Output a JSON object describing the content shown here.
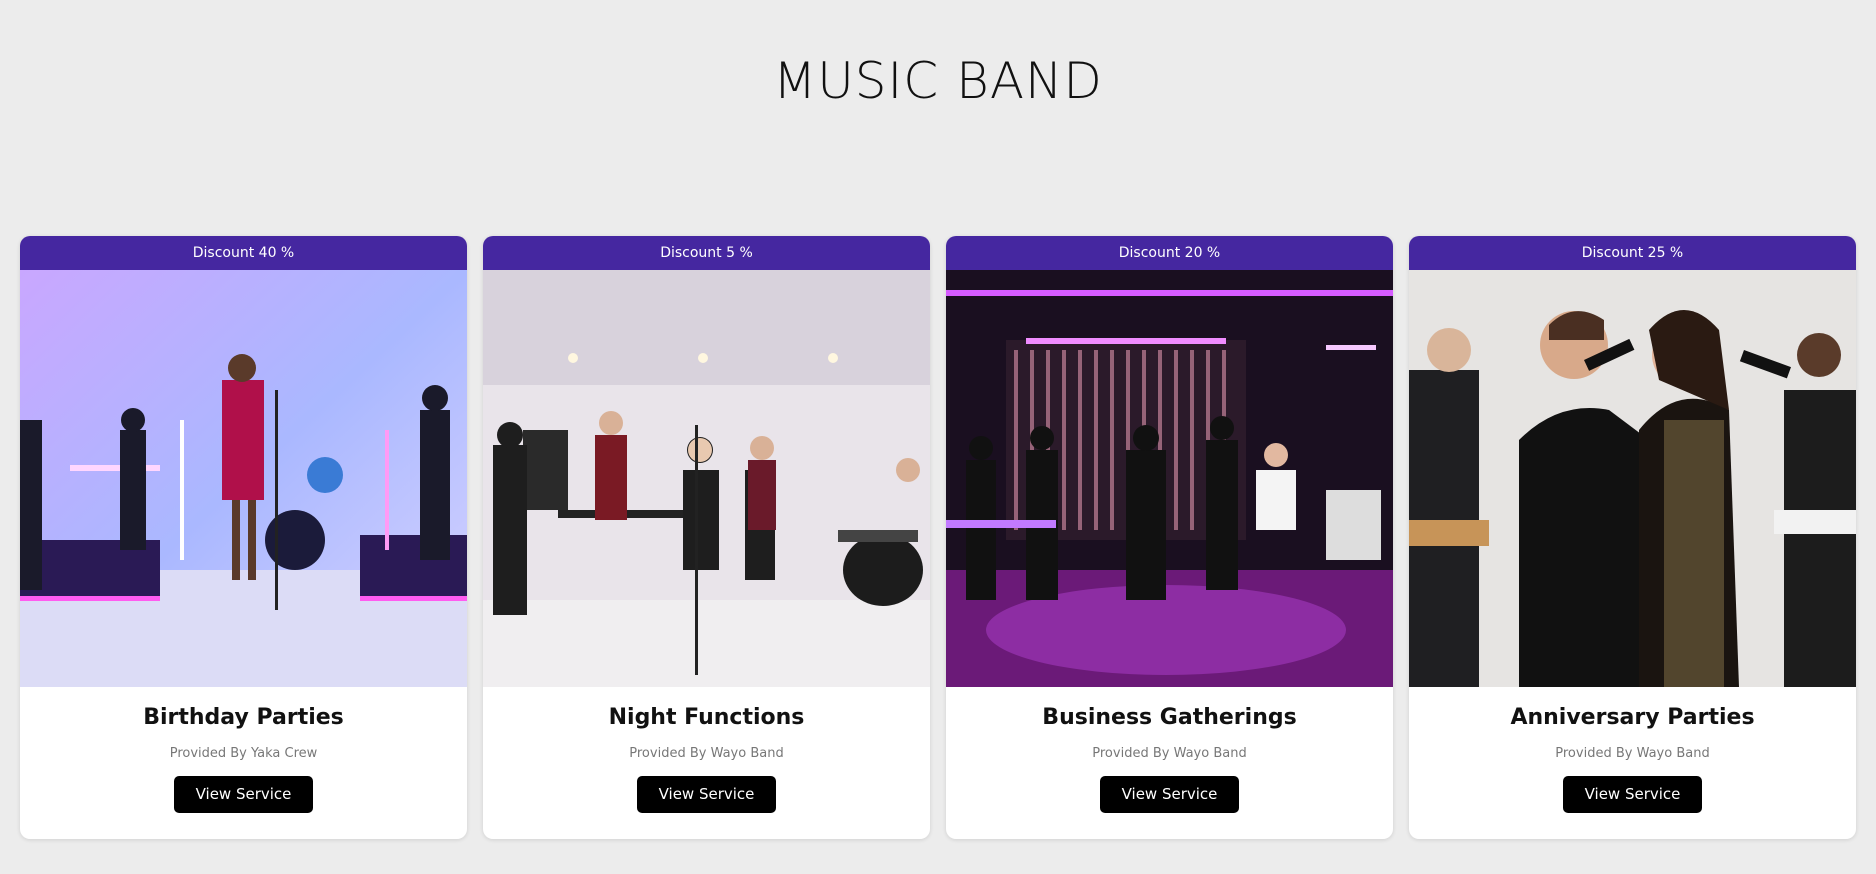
{
  "header": {
    "title": "MUSIC BAND"
  },
  "cards": [
    {
      "discount": "Discount 40 %",
      "title": "Birthday Parties",
      "provider": "Provided By Yaka Crew",
      "button": "View Service",
      "photo": "band-performance-photo-blue-neon"
    },
    {
      "discount": "Discount 5 %",
      "title": "Night Functions",
      "provider": "Provided By Wayo Band",
      "button": "View Service",
      "photo": "band-performance-photo-white-room"
    },
    {
      "discount": "Discount 20 %",
      "title": "Business Gatherings",
      "provider": "Provided By Wayo Band",
      "button": "View Service",
      "photo": "band-performance-photo-purple-studio"
    },
    {
      "discount": "Discount 25 %",
      "title": "Anniversary Parties",
      "provider": "Provided By Wayo Band",
      "button": "View Service",
      "photo": "singers-duet-photo"
    }
  ],
  "colors": {
    "banner": "#4527a0",
    "background": "#ececec",
    "button": "#000000"
  }
}
